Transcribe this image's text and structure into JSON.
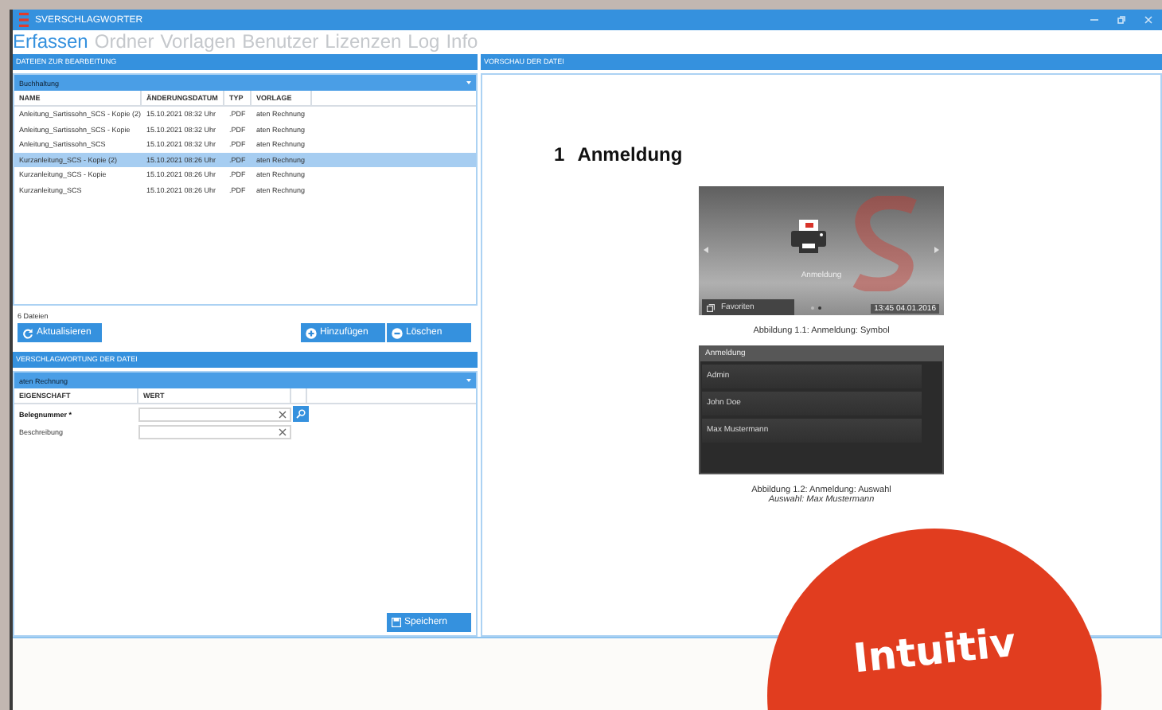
{
  "window": {
    "title": "SVERSCHLAGWORTER"
  },
  "menu": [
    {
      "label": "Erfassen",
      "selected": true
    },
    {
      "label": "Ordner",
      "selected": false
    },
    {
      "label": "Vorlagen",
      "selected": false
    },
    {
      "label": "Benutzer",
      "selected": false
    },
    {
      "label": "Lizenzen",
      "selected": false
    },
    {
      "label": "Log",
      "selected": false
    },
    {
      "label": "Info",
      "selected": false
    }
  ],
  "files_panel": {
    "title": "DATEIEN ZUR BEARBEITUNG",
    "folder": "Buchhaltung",
    "columns": [
      "NAME",
      "ÄNDERUNGSDATUM",
      "TYP",
      "VORLAGE"
    ],
    "rows": [
      {
        "cells": [
          "Anleitung_Sartissohn_SCS - Kopie (2)",
          "15.10.2021 08:32 Uhr",
          ".PDF",
          "aten Rechnung"
        ],
        "selected": false
      },
      {
        "cells": [
          "Anleitung_Sartissohn_SCS - Kopie",
          "15.10.2021 08:32 Uhr",
          ".PDF",
          "aten Rechnung"
        ],
        "selected": false
      },
      {
        "cells": [
          "Anleitung_Sartissohn_SCS",
          "15.10.2021 08:32 Uhr",
          ".PDF",
          "aten Rechnung"
        ],
        "selected": false
      },
      {
        "cells": [
          "Kurzanleitung_SCS - Kopie (2)",
          "15.10.2021 08:26 Uhr",
          ".PDF",
          "aten Rechnung"
        ],
        "selected": true
      },
      {
        "cells": [
          "Kurzanleitung_SCS - Kopie",
          "15.10.2021 08:26 Uhr",
          ".PDF",
          "aten Rechnung"
        ],
        "selected": false
      },
      {
        "cells": [
          "Kurzanleitung_SCS",
          "15.10.2021 08:26 Uhr",
          ".PDF",
          "aten Rechnung"
        ],
        "selected": false
      }
    ],
    "count": "6 Dateien",
    "buttons": [
      {
        "kind": "refresh",
        "label": "Aktualisieren"
      },
      {
        "kind": "add",
        "label": "Hinzufügen"
      },
      {
        "kind": "delete",
        "label": "Löschen"
      }
    ]
  },
  "tagging_panel": {
    "title": "VERSCHLAGWORTUNG DER DATEI",
    "template": "aten Rechnung",
    "columns": [
      "EIGENSCHAFT",
      "WERT"
    ],
    "fields": [
      {
        "label": "Belegnummer *",
        "required": true,
        "lookup": true
      },
      {
        "label": "Beschreibung",
        "required": false,
        "lookup": false
      }
    ],
    "save_button": "Speichern"
  },
  "preview_panel": {
    "title": "VORSCHAU DER DATEI",
    "heading_number": "1",
    "heading": "Anmeldung",
    "figures": [
      {
        "kind": "device_screen",
        "icon_label": "Anmeldung",
        "tab": "Favoriten",
        "time": "13:45  04.01.2016",
        "caption": "Abbildung 1.1: Anmeldung: Symbol"
      },
      {
        "kind": "login_list",
        "header": "Anmeldung",
        "users": [
          "Admin",
          "John Doe",
          "Max Mustermann"
        ],
        "caption": "Abbildung 1.2: Anmeldung: Auswahl",
        "note": "Auswahl: Max Mustermann"
      }
    ]
  },
  "badge": {
    "text": "Intuitiv"
  }
}
